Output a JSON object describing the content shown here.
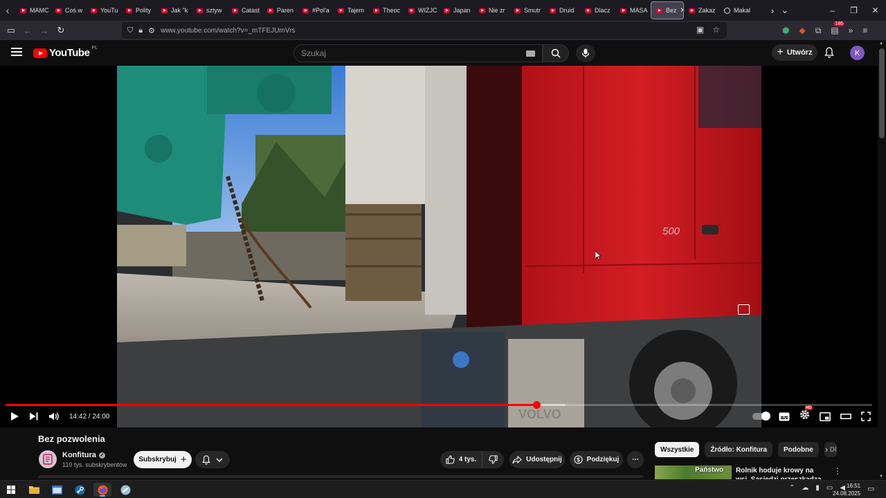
{
  "browser": {
    "tabs": [
      {
        "label": "MAMC"
      },
      {
        "label": "Coś w"
      },
      {
        "label": "YouTu"
      },
      {
        "label": "Polity"
      },
      {
        "label": "Jak \"k"
      },
      {
        "label": "sztyw"
      },
      {
        "label": "Catast"
      },
      {
        "label": "Paren"
      },
      {
        "label": "#Pol'a"
      },
      {
        "label": "Tajem"
      },
      {
        "label": "Theoc"
      },
      {
        "label": "WIZJC"
      },
      {
        "label": "Japan"
      },
      {
        "label": "Nie zr"
      },
      {
        "label": "Smutr"
      },
      {
        "label": "Druid"
      },
      {
        "label": "Dlacz"
      },
      {
        "label": "MASA"
      },
      {
        "label": "Bez",
        "active": true
      },
      {
        "label": "Zakaz"
      },
      {
        "label": "Makal",
        "round_icon": true
      }
    ],
    "url": "www.youtube.com/watch?v=_mTFEJUmVrs",
    "extensions_badge": "186",
    "accent_color": "#e1002d"
  },
  "youtube": {
    "logo_text": "YouTube",
    "country_code": "PL",
    "search_placeholder": "Szukaj",
    "create_label": "Utwórz",
    "avatar_letter": "K"
  },
  "player": {
    "current_time": "14:42",
    "duration": "24:00",
    "time_display": "14:42 / 24:00",
    "played_fraction": 0.613,
    "buffered_fraction": 0.645,
    "progress_color": "#ff0000"
  },
  "video": {
    "title": "Bez pozwolenia",
    "channel_name": "Konfitura",
    "subscribers": "110 tys. subskrybentów",
    "subscribe_label": "Subskrybuj",
    "likes": "4 tys.",
    "share_label": "Udostępnij",
    "thanks_label": "Podziękuj"
  },
  "sidebar": {
    "chips": [
      {
        "label": "Wszystkie",
        "active": true
      },
      {
        "label": "Źródło: Konfitura"
      },
      {
        "label": "Podobne"
      },
      {
        "label": "Dla"
      }
    ],
    "recommendation": {
      "thumb_text": "Państwo",
      "title": "Rolnik hoduje krowy na wsi. Sąsiedzi przeszkadza zapac"
    }
  },
  "taskbar": {
    "time": "16:51",
    "date": "24.08.2025"
  }
}
